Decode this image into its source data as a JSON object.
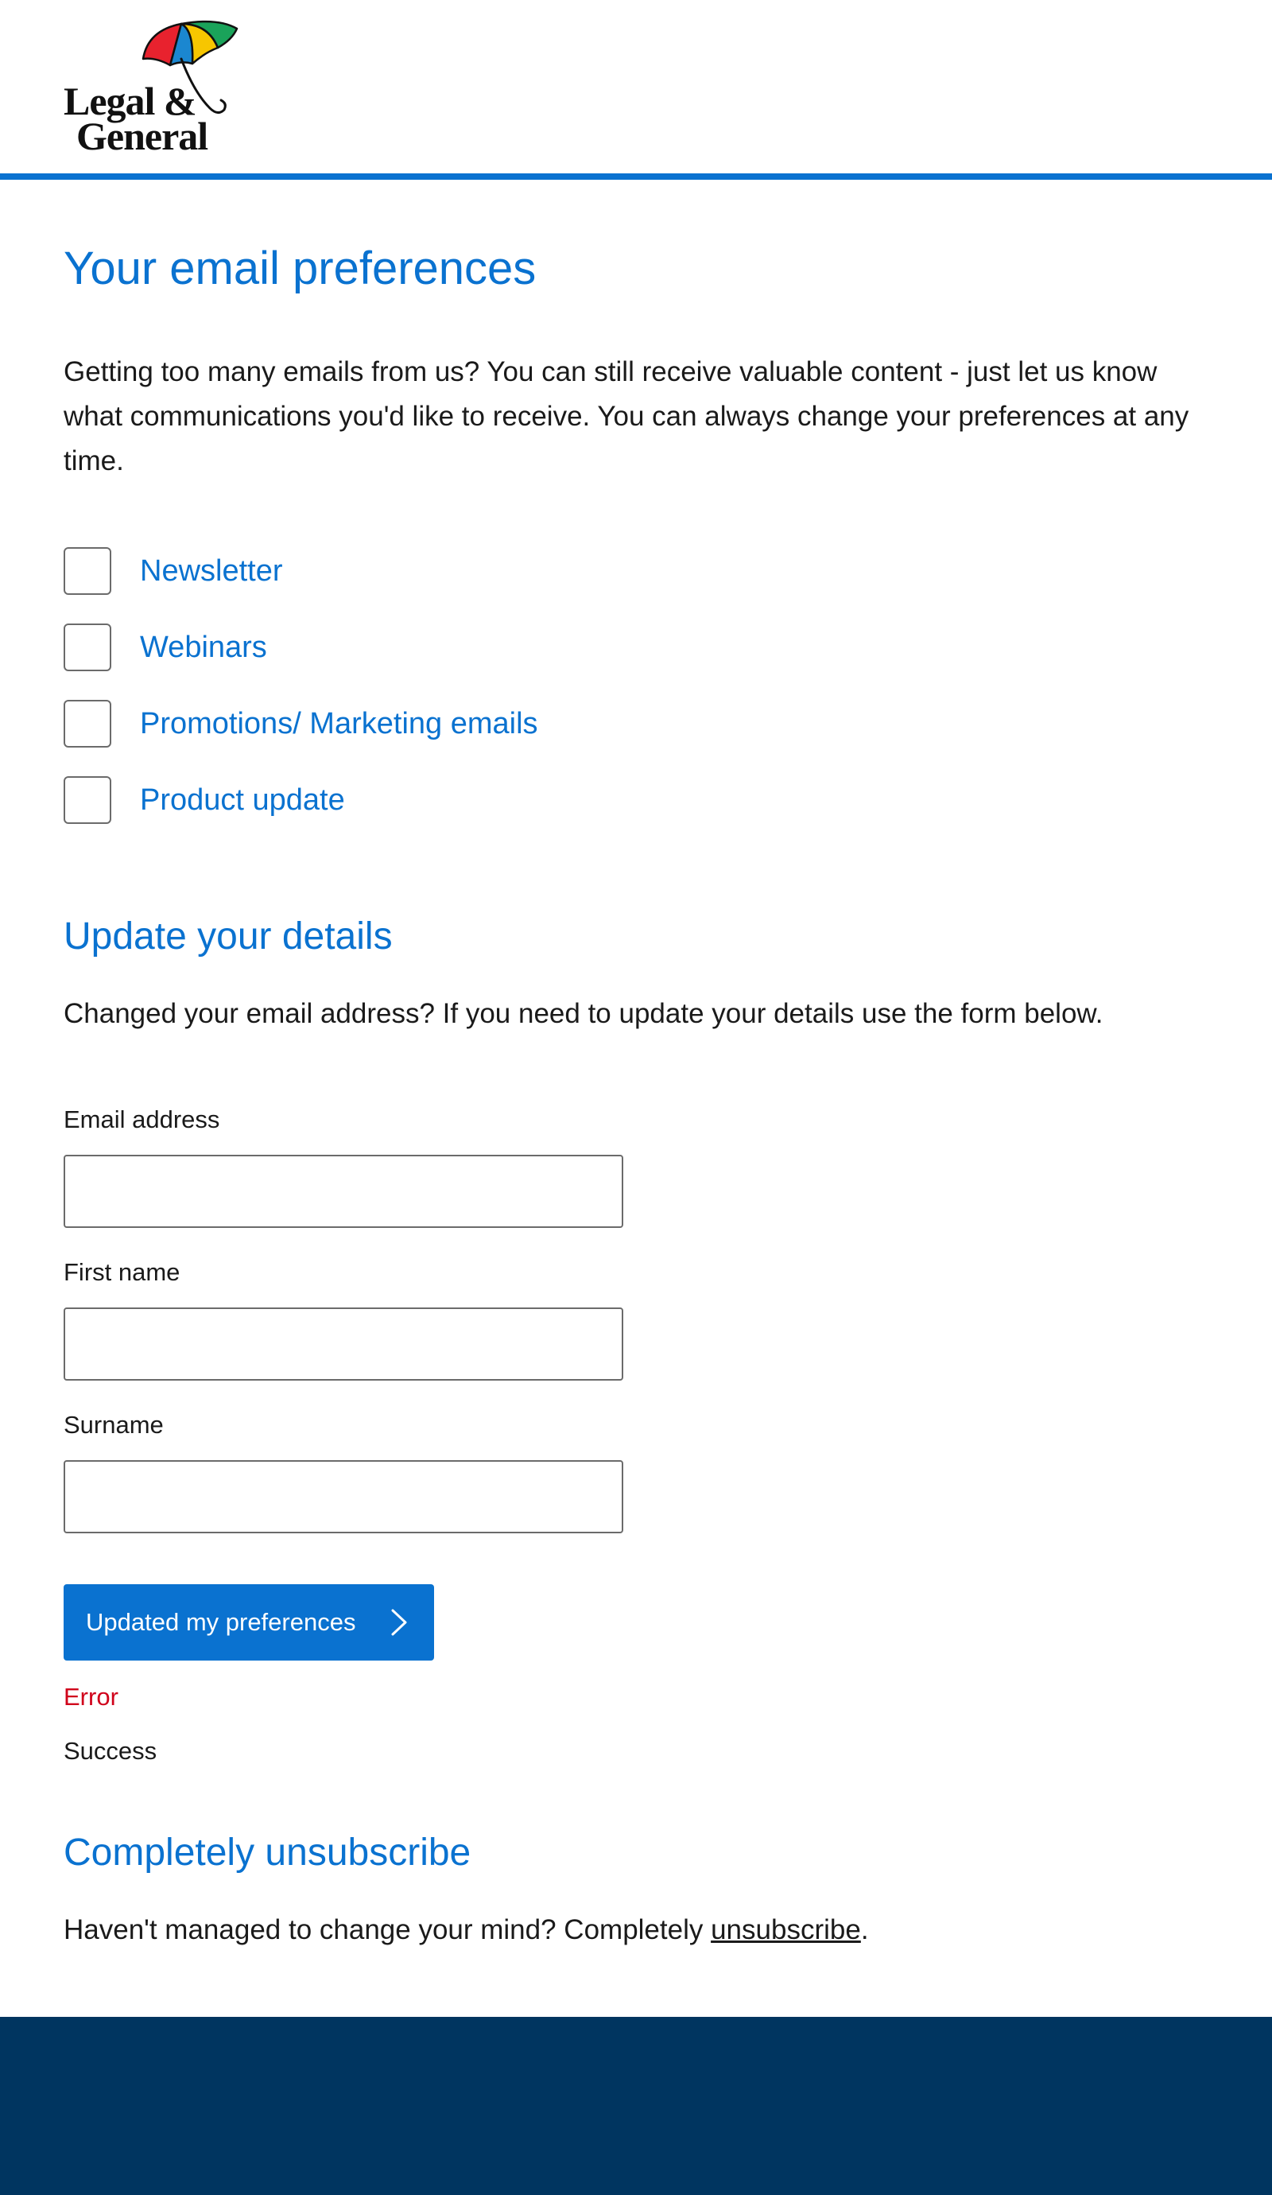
{
  "header": {
    "logo": {
      "line1": "Legal &",
      "line2": "General",
      "umbrella_colors": [
        "#e8222e",
        "#1b87d0",
        "#f7c600",
        "#1aa35a"
      ]
    }
  },
  "main": {
    "title": "Your email preferences",
    "intro": "Getting too many emails from us? You can still receive valuable content - just let us know what communications you'd like to receive. You can always change your preferences at any time.",
    "preferences": [
      {
        "label": "Newsletter",
        "checked": false
      },
      {
        "label": "Webinars",
        "checked": false
      },
      {
        "label": "Promotions/ Marketing emails",
        "checked": false
      },
      {
        "label": "Product update",
        "checked": false
      }
    ]
  },
  "update_details": {
    "heading": "Update your details",
    "description": "Changed your email address? If you need to update your details use the form below.",
    "fields": {
      "email": {
        "label": "Email address",
        "value": ""
      },
      "first_name": {
        "label": "First name",
        "value": ""
      },
      "surname": {
        "label": "Surname",
        "value": ""
      }
    },
    "submit_label": "Updated my preferences",
    "error_text": "Error",
    "success_text": "Success"
  },
  "unsubscribe": {
    "heading": "Completely unsubscribe",
    "text_before": "Haven't managed to change your mind? Completely ",
    "link_text": "unsubscribe",
    "text_after": "."
  },
  "colors": {
    "accent": "#0a72d0",
    "error": "#d0021b",
    "footer": "#003560"
  }
}
